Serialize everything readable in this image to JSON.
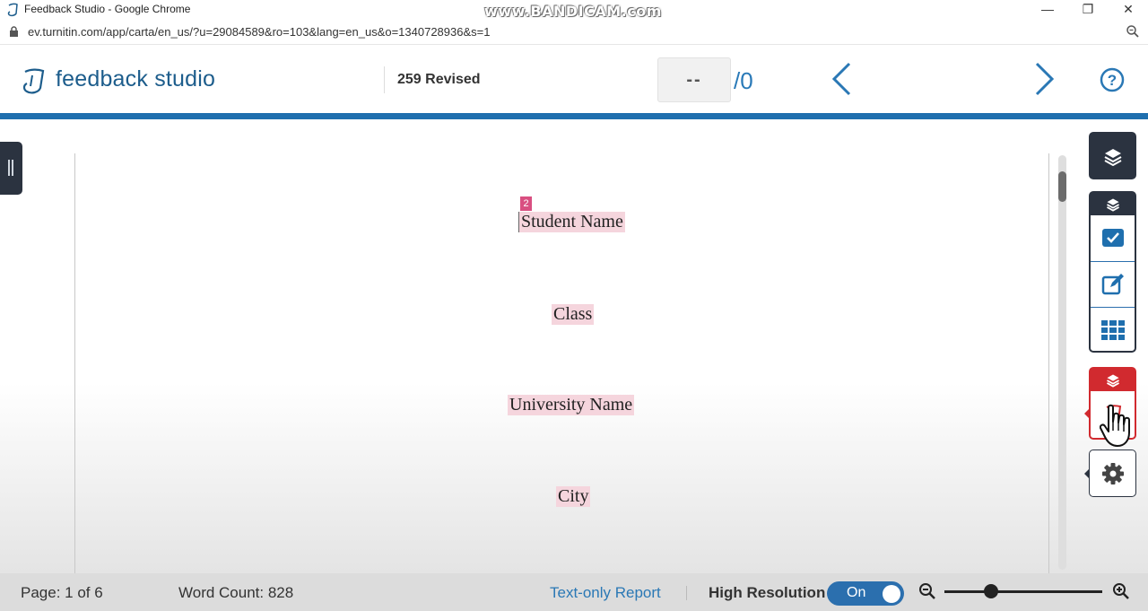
{
  "browser": {
    "window_title": "Feedback Studio - Google Chrome",
    "watermark": "www.BANDICAM.com",
    "url": "ev.turnitin.com/app/carta/en_us/?u=29084589&ro=103&lang=en_us&o=1340728936&s=1",
    "controls": {
      "minimize": "—",
      "restore": "❐",
      "close": "✕"
    }
  },
  "header": {
    "brand": "feedback studio",
    "paper_title": "259 Revised",
    "similarity_value": "--",
    "similarity_total": "/0",
    "icons": {
      "prev": "chevron-left-icon",
      "next": "chevron-right-icon",
      "help": "help-icon"
    },
    "accent_color": "#1f6fae"
  },
  "document": {
    "match_badge": "2",
    "lines": [
      "Student Name",
      "Class",
      "University Name",
      "City"
    ],
    "highlight_color": "#f5d5dd",
    "badge_color": "#d94f81"
  },
  "side_panel": {
    "buttons": [
      "layers-icon",
      "checkmark-icon",
      "edit-icon",
      "grid-icon",
      "layers-icon",
      "turnitin-similarity-icon",
      "gear-icon"
    ],
    "red_color": "#d12a2f",
    "dark_color": "#2b3340"
  },
  "footer": {
    "page": "Page: 1 of 6",
    "word_count": "Word Count: 828",
    "text_only_report": "Text-only Report",
    "high_resolution": "High Resolution",
    "toggle_label": "On",
    "toggle_state": true
  }
}
